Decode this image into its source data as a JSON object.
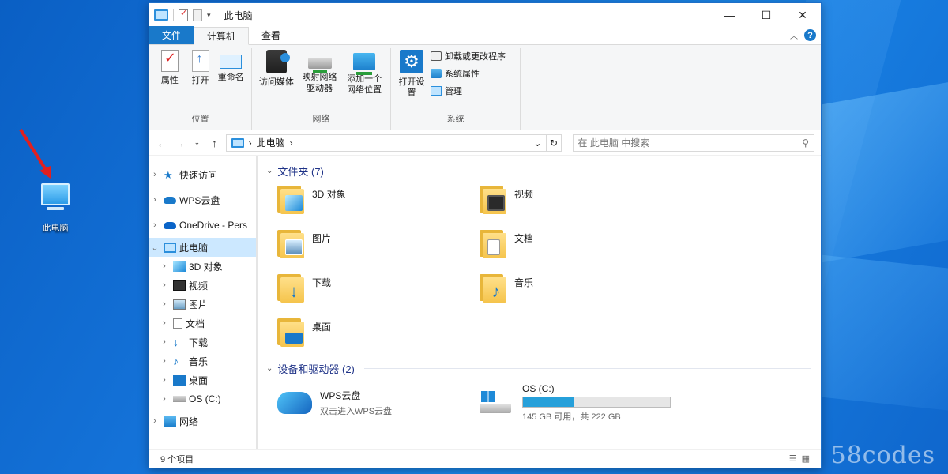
{
  "desktop": {
    "icon_label": "此电脑",
    "watermark": "58codes"
  },
  "window": {
    "title": "此电脑",
    "buttons": {
      "minimize": "—",
      "maximize": "☐",
      "close": "✕"
    }
  },
  "ribbon": {
    "tabs": [
      {
        "label": "文件"
      },
      {
        "label": "计算机"
      },
      {
        "label": "查看"
      }
    ],
    "groups": {
      "location": {
        "label": "位置",
        "properties": "属性",
        "open": "打开",
        "rename": "重命名"
      },
      "network": {
        "label": "网络",
        "access_media": "访问媒体",
        "map_drive": "映射网络驱动器",
        "add_location": "添加一个网络位置"
      },
      "system": {
        "label": "系统",
        "open_settings": "打开设置",
        "uninstall": "卸载或更改程序",
        "sys_props": "系统属性",
        "manage": "管理"
      }
    }
  },
  "address": {
    "path": "此电脑",
    "search_placeholder": "在 此电脑 中搜索"
  },
  "navpane": {
    "items": [
      {
        "label": "快速访问"
      },
      {
        "label": "WPS云盘"
      },
      {
        "label": "OneDrive - Pers"
      },
      {
        "label": "此电脑"
      },
      {
        "label": "3D 对象"
      },
      {
        "label": "视频"
      },
      {
        "label": "图片"
      },
      {
        "label": "文档"
      },
      {
        "label": "下载"
      },
      {
        "label": "音乐"
      },
      {
        "label": "桌面"
      },
      {
        "label": "OS (C:)"
      },
      {
        "label": "网络"
      }
    ]
  },
  "folders": {
    "header": "文件夹 (7)",
    "items": [
      {
        "label": "3D 对象"
      },
      {
        "label": "视频"
      },
      {
        "label": "图片"
      },
      {
        "label": "文档"
      },
      {
        "label": "下载"
      },
      {
        "label": "音乐"
      },
      {
        "label": "桌面"
      }
    ]
  },
  "devices": {
    "header": "设备和驱动器 (2)",
    "wps": {
      "name": "WPS云盘",
      "sub": "双击进入WPS云盘"
    },
    "os": {
      "name": "OS (C:)",
      "space": "145 GB 可用，共 222 GB",
      "used_fraction": 0.347
    }
  },
  "status": {
    "count": "9 个项目"
  }
}
